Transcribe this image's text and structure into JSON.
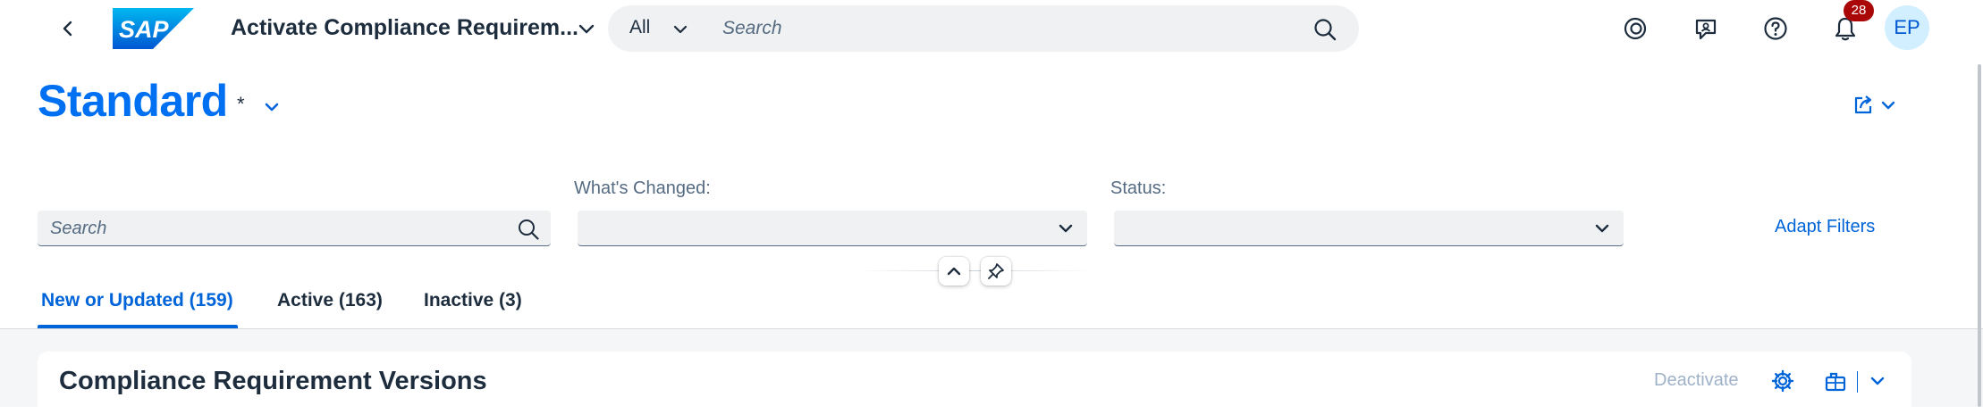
{
  "shell": {
    "app_title": "Activate Compliance Requirem...",
    "search_scope": "All",
    "search_placeholder": "Search",
    "notification_count": "28",
    "avatar_initials": "EP",
    "brand_color": "#0070f2"
  },
  "variant": {
    "name": "Standard",
    "modified_marker": "*"
  },
  "filters": {
    "search_placeholder": "Search",
    "whats_changed_label": "What's Changed:",
    "whats_changed_value": "",
    "status_label": "Status:",
    "status_value": "",
    "adapt_filters_label": "Adapt Filters"
  },
  "tabs": [
    {
      "label": "New or Updated (159)",
      "active": true
    },
    {
      "label": "Active (163)",
      "active": false
    },
    {
      "label": "Inactive (3)",
      "active": false
    }
  ],
  "table": {
    "title": "Compliance Requirement Versions",
    "deactivate_label": "Deactivate"
  },
  "icons": [
    "back-icon",
    "sap-logo",
    "chevron-down-icon",
    "search-icon",
    "copilot-icon",
    "feedback-icon",
    "help-icon",
    "bell-icon",
    "share-icon",
    "collapse-icon",
    "pin-icon",
    "settings-icon",
    "export-icon"
  ]
}
